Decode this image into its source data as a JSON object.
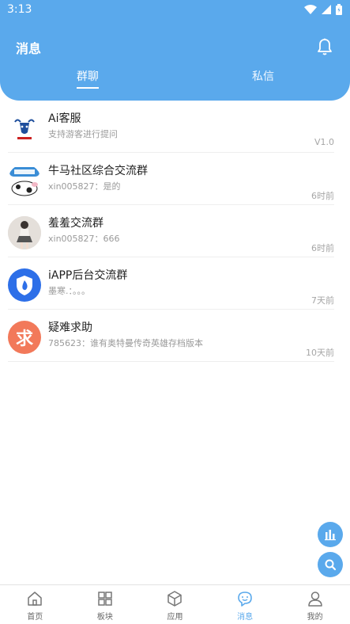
{
  "status_bar": {
    "time": "3:13"
  },
  "header": {
    "title": "消息",
    "bell_icon": "bell-icon"
  },
  "tabs": [
    {
      "label": "群聊",
      "active": true
    },
    {
      "label": "私信",
      "active": false
    }
  ],
  "conversations": [
    {
      "name": "Ai客服",
      "message": "支持游客进行提问",
      "time": "V1.0",
      "avatar": "cow-logo"
    },
    {
      "name": "牛马社区综合交流群",
      "message": "xin005827：是的",
      "time": "6时前",
      "avatar": "cow-cartoon"
    },
    {
      "name": "羞羞交流群",
      "message": "xin005827：666",
      "time": "6时前",
      "avatar": "person-photo"
    },
    {
      "name": "iAPP后台交流群",
      "message": "墨寒.：。。。",
      "time": "7天前",
      "avatar": "shield-flame"
    },
    {
      "name": "疑难求助",
      "message": "785623：谁有奥特曼传奇英雄存档版本",
      "time": "10天前",
      "avatar": "qiu-badge",
      "avatar_text": "求"
    }
  ],
  "nav": [
    {
      "label": "首页",
      "icon": "home-icon",
      "active": false
    },
    {
      "label": "板块",
      "icon": "grid-icon",
      "active": false
    },
    {
      "label": "应用",
      "icon": "cube-icon",
      "active": false
    },
    {
      "label": "消息",
      "icon": "chat-icon",
      "active": true
    },
    {
      "label": "我的",
      "icon": "user-icon",
      "active": false
    }
  ],
  "colors": {
    "primary": "#5AA9EC",
    "text": "#222222",
    "muted": "#9a9a9a"
  }
}
